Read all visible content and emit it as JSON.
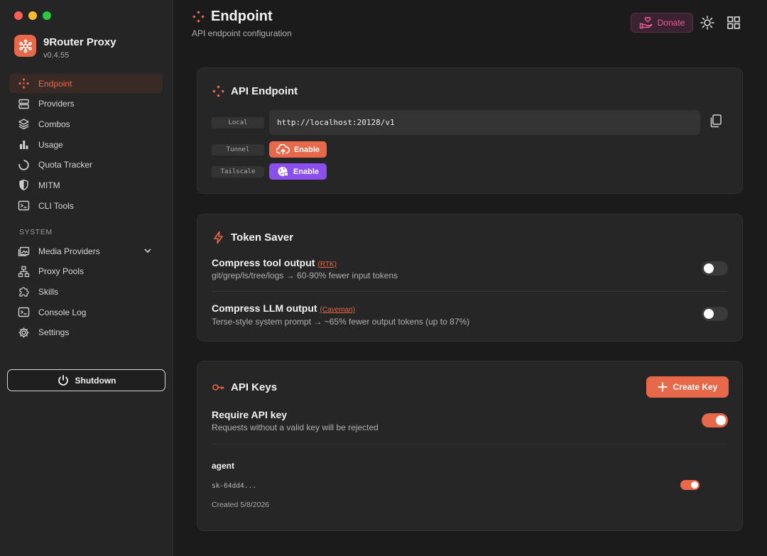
{
  "window": {
    "traffic_colors": [
      "#ff5f57",
      "#febc2e",
      "#28c840"
    ]
  },
  "brand": {
    "name": "9Router Proxy",
    "version": "v0.4.55",
    "accent": "#e8694a"
  },
  "sidebar": {
    "items": [
      {
        "label": "Endpoint",
        "icon": "endpoint-diamond-icon",
        "active": true
      },
      {
        "label": "Providers",
        "icon": "server-icon"
      },
      {
        "label": "Combos",
        "icon": "layers-icon"
      },
      {
        "label": "Usage",
        "icon": "bar-chart-icon"
      },
      {
        "label": "Quota Tracker",
        "icon": "progress-ring-icon"
      },
      {
        "label": "MITM",
        "icon": "shield-icon"
      },
      {
        "label": "CLI Tools",
        "icon": "terminal-icon"
      }
    ],
    "system_label": "SYSTEM",
    "system_items": [
      {
        "label": "Media Providers",
        "icon": "image-stack-icon",
        "expandable": true
      },
      {
        "label": "Proxy Pools",
        "icon": "hierarchy-icon"
      },
      {
        "label": "Skills",
        "icon": "puzzle-icon"
      },
      {
        "label": "Console Log",
        "icon": "console-icon"
      },
      {
        "label": "Settings",
        "icon": "gear-icon"
      }
    ],
    "shutdown_label": "Shutdown"
  },
  "header": {
    "title": "Endpoint",
    "subtitle": "API endpoint configuration",
    "donate_label": "Donate"
  },
  "api_endpoint": {
    "title": "API Endpoint",
    "local_label": "Local",
    "local_url": "http://localhost:20128/v1",
    "tunnel_label": "Tunnel",
    "tunnel_button": "Enable",
    "tailscale_label": "Tailscale",
    "tailscale_button": "Enable"
  },
  "token_saver": {
    "title": "Token Saver",
    "rows": [
      {
        "title": "Compress tool output",
        "tag": "(RTK)",
        "desc": "git/grep/ls/tree/logs → 60-90% fewer input tokens",
        "enabled": false
      },
      {
        "title": "Compress LLM output",
        "tag": "(Caveman)",
        "desc": "Terse-style system prompt → ~65% fewer output tokens (up to 87%)",
        "enabled": false
      }
    ]
  },
  "api_keys": {
    "title": "API Keys",
    "create_label": "Create Key",
    "require_title": "Require API key",
    "require_desc": "Requests without a valid key will be rejected",
    "require_enabled": true,
    "keys": [
      {
        "name": "agent",
        "key": "sk-64dd4...",
        "created": "Created 5/8/2026",
        "enabled": true
      }
    ]
  }
}
